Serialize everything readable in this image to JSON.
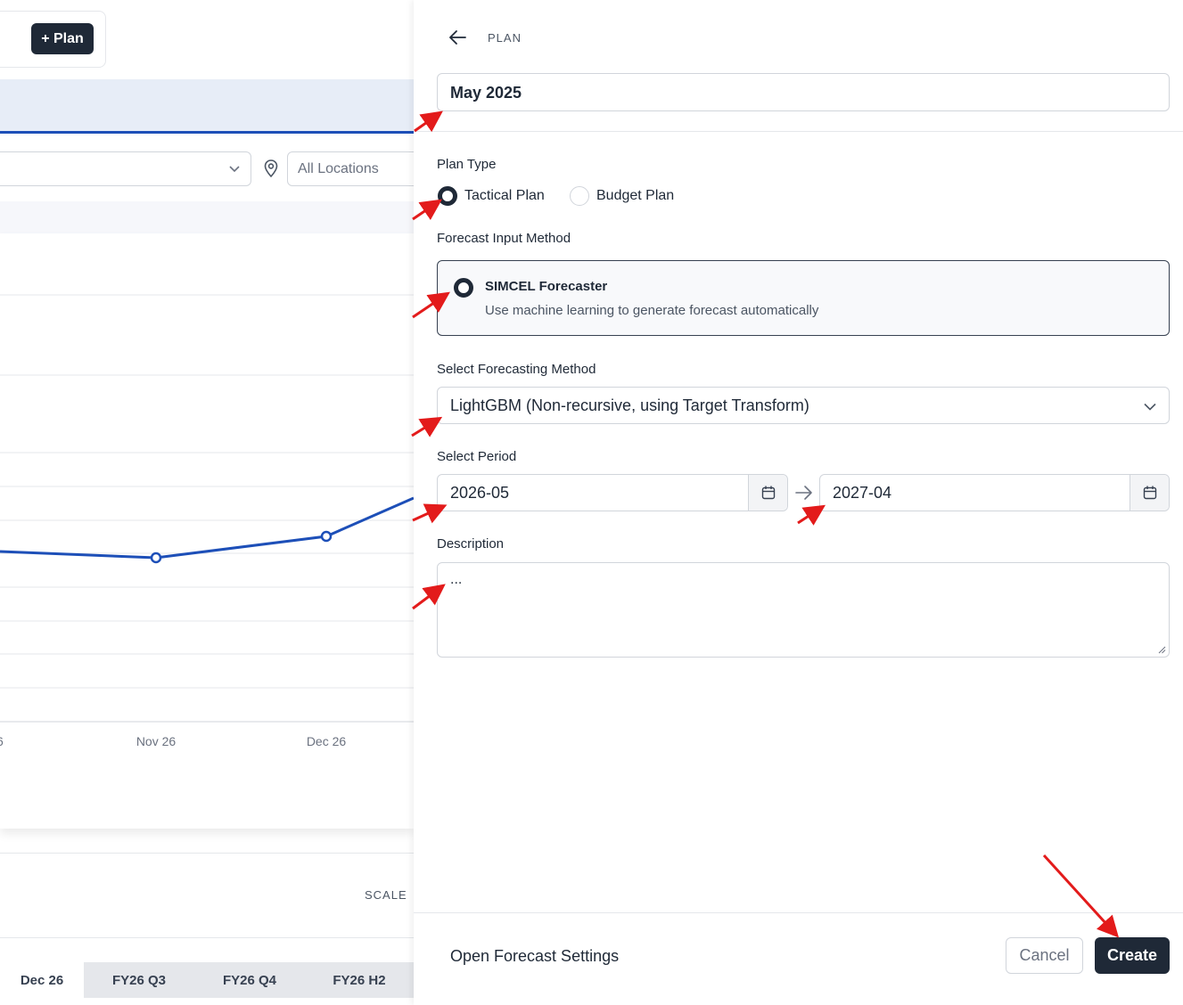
{
  "background": {
    "plan_button_label": "+ Plan",
    "location_filter_placeholder": "All Locations",
    "chart": {
      "x_tick_labels": [
        "6",
        "Nov 26",
        "Dec 26"
      ]
    },
    "scale_label": "SCALE",
    "period_columns": [
      {
        "label": "Dec 26",
        "shaded": false
      },
      {
        "label": "FY26 Q3",
        "shaded": true
      },
      {
        "label": "FY26 Q4",
        "shaded": true
      },
      {
        "label": "FY26 H2",
        "shaded": true
      }
    ]
  },
  "drawer": {
    "breadcrumb": "PLAN",
    "plan_name_value": "May 2025",
    "plan_type": {
      "label": "Plan Type",
      "options": [
        {
          "label": "Tactical Plan",
          "selected": true
        },
        {
          "label": "Budget Plan",
          "selected": false
        }
      ]
    },
    "forecast_input": {
      "label": "Forecast Input Method",
      "option_title": "SIMCEL Forecaster",
      "option_description": "Use machine learning to generate forecast automatically"
    },
    "forecasting_method": {
      "label": "Select Forecasting Method",
      "selected_value": "LightGBM (Non-recursive, using Target Transform)"
    },
    "period": {
      "label": "Select Period",
      "start_value": "2026-05",
      "end_value": "2027-04"
    },
    "description": {
      "label": "Description",
      "value": "..."
    },
    "footer": {
      "settings_link": "Open Forecast Settings",
      "cancel_label": "Cancel",
      "create_label": "Create"
    }
  },
  "colors": {
    "primary_dark": "#1f2937",
    "chart_line": "#1d4fb8",
    "annotation_arrow": "#e31b1b"
  }
}
